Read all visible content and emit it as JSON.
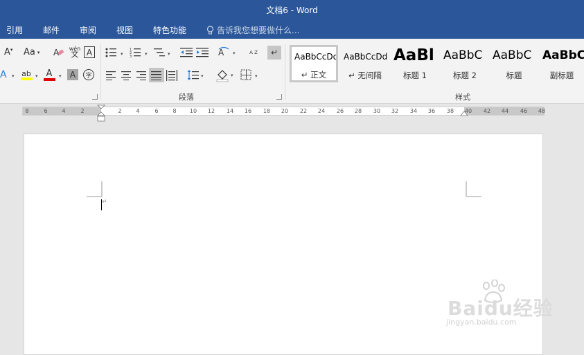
{
  "window": {
    "title": "文档6 - Word"
  },
  "menu": {
    "tabs": [
      "引用",
      "邮件",
      "审阅",
      "视图",
      "特色功能"
    ],
    "search_placeholder": "告诉我您想要做什么..."
  },
  "font_group": {
    "shrink_label": "A",
    "case_label": "Aa",
    "phonetic_label": "wén",
    "border_char_label": "A",
    "text_effect_label": "A",
    "highlight_label": "ab",
    "font_color_label": "A",
    "shading_label": "A",
    "enclose_label": "字"
  },
  "paragraph_group": {
    "label": "段落",
    "sort_label": "A Z"
  },
  "styles_group": {
    "label": "样式",
    "items": [
      {
        "sample": "AaBbCcDd",
        "name": "↵ 正文",
        "selected": true
      },
      {
        "sample": "AaBbCcDd",
        "name": "↵ 无间隔",
        "selected": false
      },
      {
        "sample": "AaBl",
        "name": "标题 1",
        "selected": false
      },
      {
        "sample": "AaBbC",
        "name": "标题 2",
        "selected": false
      },
      {
        "sample": "AaBbC",
        "name": "标题",
        "selected": false
      },
      {
        "sample": "AaBbC",
        "name": "副标题",
        "selected": false
      }
    ]
  },
  "ruler": {
    "left_numbers": [
      "8",
      "6",
      "4",
      "2"
    ],
    "right_numbers": [
      "2",
      "4",
      "6",
      "8",
      "10",
      "12",
      "14",
      "16",
      "18",
      "20",
      "22",
      "24",
      "26",
      "28",
      "30",
      "32",
      "34",
      "36",
      "38",
      "40",
      "42",
      "44",
      "46",
      "48"
    ]
  },
  "document": {
    "paragraph_mark": "↵"
  },
  "watermark": {
    "brand": "Baidu经验",
    "url": "jingyan.baidu.com"
  },
  "colors": {
    "titlebar": "#2b579a",
    "highlight": "#ffff00",
    "font_color": "#e00000"
  }
}
